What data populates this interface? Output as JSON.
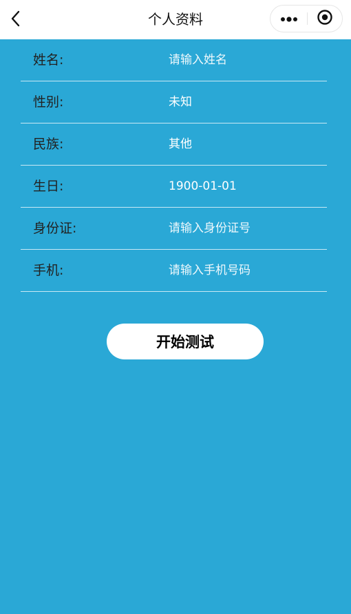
{
  "navbar": {
    "title": "个人资料",
    "back_icon": "chevron-left-icon",
    "more_icon": "more-dots-icon",
    "close_icon": "target-circle-icon"
  },
  "form": {
    "rows": [
      {
        "label": "姓名:",
        "value": "请输入姓名",
        "is_placeholder": true
      },
      {
        "label": "性别:",
        "value": "未知",
        "is_placeholder": false
      },
      {
        "label": "民族:",
        "value": "其他",
        "is_placeholder": false
      },
      {
        "label": "生日:",
        "value": "1900-01-01",
        "is_placeholder": false
      },
      {
        "label": "身份证:",
        "value": "请输入身份证号",
        "is_placeholder": true
      },
      {
        "label": "手机:",
        "value": "请输入手机号码",
        "is_placeholder": true
      }
    ]
  },
  "actions": {
    "start_label": "开始测试"
  },
  "colors": {
    "background": "#2aa8d6",
    "navbar": "#ffffff",
    "button": "#ffffff"
  }
}
